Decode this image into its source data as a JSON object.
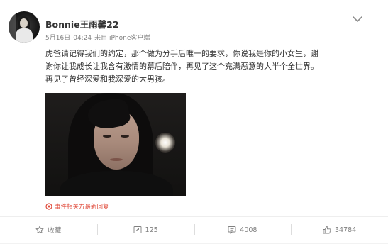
{
  "post": {
    "author": "Bonnie王雨馨22",
    "meta": {
      "date": "5月16日",
      "time": "04:24",
      "source": "来自 iPhone客户端"
    },
    "content_lines": [
      "虎爸请记得我们的约定，那个做为分手后唯一的要求，你说我是你的小女生，谢",
      "谢你让我成长让我含有激情的幕后陪伴，再见了这个充满恶意的大半个全世界。",
      "再见了曾经深爱和我深爱的大男孩。"
    ],
    "event_link": "事件相关方最新回复",
    "image": {
      "description_icon": "photo-icon"
    }
  },
  "actions": {
    "favorite": {
      "label": "收藏",
      "icon": "star-icon"
    },
    "repost": {
      "count": "125",
      "icon": "repost-icon"
    },
    "comment": {
      "count": "4008",
      "icon": "comment-icon"
    },
    "like": {
      "count": "34784",
      "icon": "thumbs-up-icon"
    }
  },
  "colors": {
    "accent": "#e04a3a",
    "text": "#333333",
    "muted": "#808080"
  }
}
